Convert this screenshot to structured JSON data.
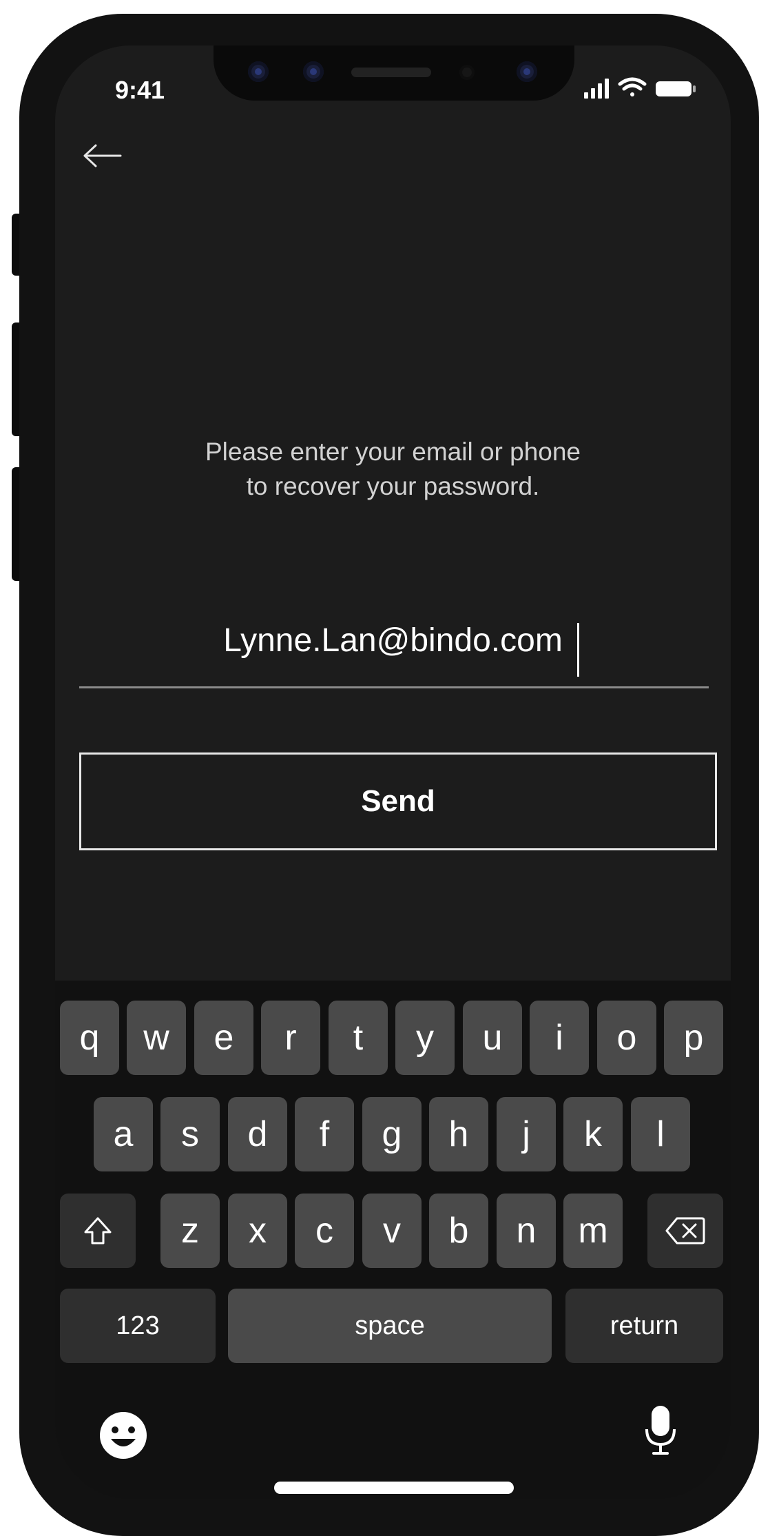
{
  "status_bar": {
    "time": "9:41"
  },
  "nav": {
    "back_icon": "arrow-left-icon"
  },
  "recovery": {
    "message_line1": "Please enter your email or phone",
    "message_line2": "to recover your password.",
    "email_value": "Lynne.Lan@bindo.com"
  },
  "actions": {
    "send_label": "Send"
  },
  "keyboard": {
    "row1": [
      "q",
      "w",
      "e",
      "r",
      "t",
      "y",
      "u",
      "i",
      "o",
      "p"
    ],
    "row2": [
      "a",
      "s",
      "d",
      "f",
      "g",
      "h",
      "j",
      "k",
      "l"
    ],
    "row3": [
      "z",
      "x",
      "c",
      "v",
      "b",
      "n",
      "m"
    ],
    "numbers_label": "123",
    "space_label": "space",
    "return_label": "return",
    "icons": {
      "shift": "shift-icon",
      "backspace": "backspace-icon",
      "emoji": "emoji-icon",
      "mic": "microphone-icon"
    }
  },
  "colors": {
    "screen_bg": "#1c1c1c",
    "keyboard_bg": "#111111",
    "key_bg": "#4a4a4a",
    "key_dark_bg": "#2f2f2f"
  }
}
